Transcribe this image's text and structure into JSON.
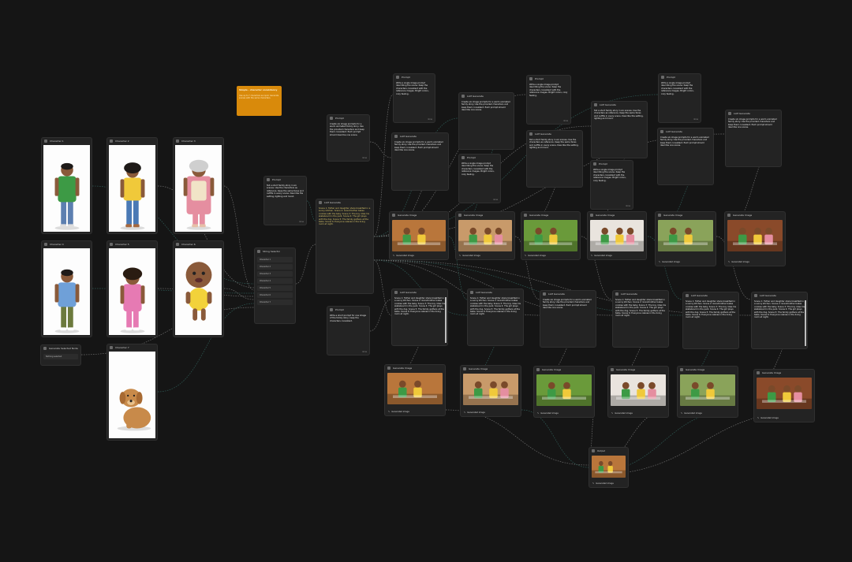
{
  "canvas": {
    "background": "#151515",
    "accent": "#d98a0b"
  },
  "characters": [
    {
      "title": "Character 1",
      "icon": "man-green-shirt-figure"
    },
    {
      "title": "Character 2",
      "icon": "woman-yellow-top-figure"
    },
    {
      "title": "Character 3",
      "icon": "grandmother-apron-figure"
    },
    {
      "title": "Character 4",
      "icon": "boy-skateboard-figure"
    },
    {
      "title": "Character 5",
      "icon": "girl-holding-doll-figure"
    },
    {
      "title": "Character 6",
      "icon": "baby-yellow-onesie-figure"
    },
    {
      "title": "Character 7",
      "icon": "dog-figure"
    }
  ],
  "sticky_note": {
    "title": "Simple - character consistency",
    "body": "Use up to 7 characters as input. Generate scenes with the same characters."
  },
  "text_nodes": {
    "story_text": "Tell a short family story in six scenes. Use the characters as reference. Keep the same faces and outfits in every scene. Describe the setting, lighting and mood.",
    "style_text": "Create six image prompts for a warm animated family story. Use the provided characters and keep them consistent. Each prompt should describe one scene.",
    "story_text_2": "Write a single image prompt describing the scene. Keep the characters consistent with the reference images. Bright colors, cozy feeling.",
    "gold_prompt": "Scene 1: Father and daughter share breakfast in a sunny kitchen. Scene 2: Grandmother bakes cookies with the baby. Scene 3: The boy rides his skateboard in the park. Scene 4: The girl plays with the dog. Scene 5: The family gathers at the table. Scene 6: Everyone relaxes in the living room at night.",
    "short": "Write a short prompt for one image of the family story, keep the characters consistent."
  },
  "batch_node": {
    "title": "String Selector",
    "rows": [
      "Character 1",
      "Character 2",
      "Character 3",
      "Character 4",
      "Character 5",
      "Character 6",
      "Character 7"
    ]
  },
  "empty_node": {
    "title": "Generate Selected Nodes",
    "placeholder": "Nothing selected"
  },
  "scenes": [
    {
      "icon": "breakfast-scene",
      "bg": "#b9763b"
    },
    {
      "icon": "grandmother-baking-scene",
      "bg": "#c89a6a"
    },
    {
      "icon": "park-skateboard-scene",
      "bg": "#6a9a3a"
    },
    {
      "icon": "girl-and-dog-scene",
      "bg": "#e9e4de"
    },
    {
      "icon": "family-porch-scene",
      "bg": "#8aa35a"
    },
    {
      "icon": "living-room-scene",
      "bg": "#8a4a2a"
    }
  ],
  "labels": {
    "prompt": "Prompt",
    "llm": "LLM Generate",
    "image": "Generate Image",
    "final": "Output",
    "caption": "Generated image",
    "done": "done"
  }
}
